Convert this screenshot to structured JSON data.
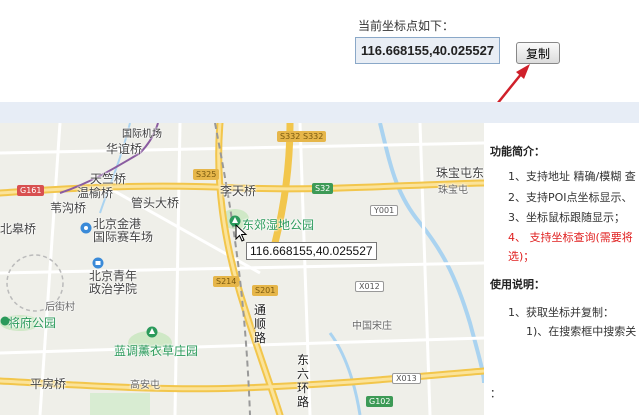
{
  "header": {
    "label": "当前坐标点如下：",
    "coord_value": "116.668155,40.025527",
    "copy_label": "复制"
  },
  "map": {
    "labels": {
      "airport": "国际机场",
      "huaqiao": "华谊桥",
      "tianzhu": "天竺桥",
      "wenyu": "温榆桥",
      "weigou": "苇沟桥",
      "guantou": "管头大桥",
      "litianqiao": "李天桥",
      "dongjiao": "东郊湿地公园",
      "beigaoqiao": "北皋桥",
      "jingang": "北京金港\n国际赛车场",
      "qingnian": "北京青年\n政治学院",
      "houjie": "后街村",
      "jiangfu": "将府公园",
      "languang": "蓝调薰衣草庄园",
      "pingfang": "平房桥",
      "gaoan": "高安屯",
      "tongshun": "通\n顺\n路",
      "dongliu": "东\n六\n环\n路",
      "songzhuang": "中国宋庄",
      "zhubao": "珠宝屯东桥",
      "zhubao2": "珠宝屯"
    },
    "shields": {
      "s332": "S332",
      "s325": "S325",
      "s32": "S32",
      "s214": "S214",
      "s201": "S201",
      "g161": "G161",
      "g102": "G102",
      "x012": "X012",
      "x013": "X013",
      "y001": "Y001"
    },
    "tooltip": "116.668155,40.025527"
  },
  "sidebar": {
    "intro_title": "功能简介：",
    "features": [
      "1、支持地址 精确/模糊 查",
      "2、支持POI点坐标显示、",
      "3、坐标鼠标跟随显示；"
    ],
    "feature_red": "4、 支持坐标查询(需要将",
    "feature_red_cont": "选)；",
    "usage_title": "使用说明：",
    "usage_1": "1、获取坐标并复制：",
    "usage_1a": "1)、在搜索框中搜索关",
    "tail": "："
  },
  "colors": {
    "accent_red": "#d0202a",
    "band": "#e7edf6",
    "road_yellow": "#f7d466",
    "water": "#aad3f0",
    "green": "#c8e6c0"
  }
}
